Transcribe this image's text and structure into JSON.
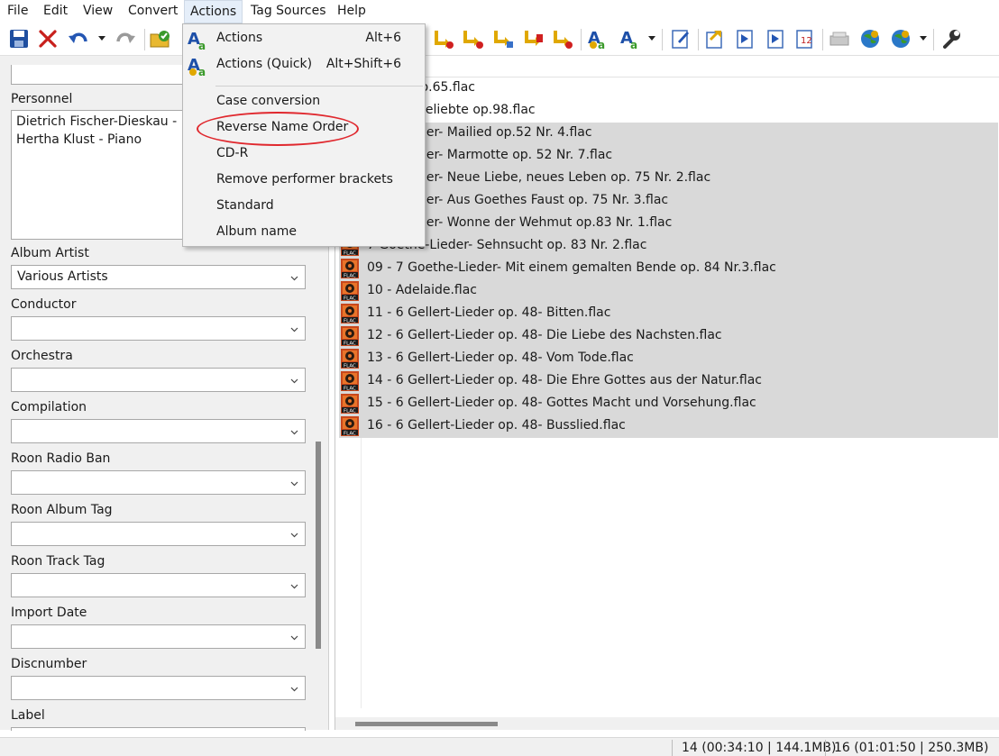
{
  "menubar": {
    "items": [
      "File",
      "Edit",
      "View",
      "Convert",
      "Actions",
      "Tag Sources",
      "Help"
    ]
  },
  "actions_menu": {
    "items": [
      {
        "label": "Actions",
        "shortcut": "Alt+6"
      },
      {
        "label": "Actions (Quick)",
        "shortcut": "Alt+Shift+6"
      },
      {
        "label": "Case conversion",
        "shortcut": ""
      },
      {
        "label": "Reverse Name Order",
        "shortcut": ""
      },
      {
        "label": "CD-R",
        "shortcut": ""
      },
      {
        "label": "Remove performer brackets",
        "shortcut": ""
      },
      {
        "label": "Standard",
        "shortcut": ""
      },
      {
        "label": "Album name",
        "shortcut": ""
      }
    ],
    "highlighted": "Reverse Name Order"
  },
  "tag_panel": {
    "personnel_label": "Personnel",
    "personnel_lines": [
      "Dietrich Fischer-Dieskau - Ba",
      "Hertha Klust - Piano"
    ],
    "fields": [
      {
        "label": "Album Artist",
        "value": "Various Artists"
      },
      {
        "label": "Conductor",
        "value": ""
      },
      {
        "label": "Orchestra",
        "value": ""
      },
      {
        "label": "Compilation",
        "value": ""
      },
      {
        "label": "Roon Radio Ban",
        "value": ""
      },
      {
        "label": "Roon Album Tag",
        "value": ""
      },
      {
        "label": "Roon Track Tag",
        "value": ""
      },
      {
        "label": "Import Date",
        "value": ""
      },
      {
        "label": "Discnumber",
        "value": ""
      },
      {
        "label": "Label",
        "value": ""
      }
    ]
  },
  "file_list": {
    "rows": [
      {
        "name": "erfido! op.65.flac",
        "selected": false
      },
      {
        "name": "e ferne Geliebte op.98.flac",
        "selected": false
      },
      {
        "name": "ethe-Lieder- Mailied op.52 Nr. 4.flac",
        "selected": true
      },
      {
        "name": "ethe-Lieder- Marmotte op. 52 Nr. 7.flac",
        "selected": true
      },
      {
        "name": "ethe-Lieder- Neue Liebe, neues Leben op. 75 Nr. 2.flac",
        "selected": true
      },
      {
        "name": "ethe-Lieder- Aus Goethes Faust op. 75 Nr. 3.flac",
        "selected": true
      },
      {
        "name": "ethe-Lieder- Wonne der Wehmut op.83 Nr. 1.flac",
        "selected": true
      },
      {
        "name": "7 Goethe-Lieder- Sehnsucht op. 83 Nr. 2.flac",
        "selected": true
      },
      {
        "name": "09 - 7 Goethe-Lieder- Mit einem gemalten Bende op. 84 Nr.3.flac",
        "selected": true
      },
      {
        "name": "10 - Adelaide.flac",
        "selected": true
      },
      {
        "name": "11 - 6 Gellert-Lieder op. 48- Bitten.flac",
        "selected": true
      },
      {
        "name": "12 - 6 Gellert-Lieder op. 48- Die Liebe des Nachsten.flac",
        "selected": true
      },
      {
        "name": "13 - 6 Gellert-Lieder op. 48- Vom Tode.flac",
        "selected": true
      },
      {
        "name": "14 - 6 Gellert-Lieder op. 48- Die Ehre Gottes aus der Natur.flac",
        "selected": true
      },
      {
        "name": "15 - 6 Gellert-Lieder op. 48- Gottes Macht und Vorsehung.flac",
        "selected": true
      },
      {
        "name": "16 - 6 Gellert-Lieder op. 48- Busslied.flac",
        "selected": true
      }
    ],
    "file_icon": "flac-file-icon"
  },
  "statusbar": {
    "selected": "14 (00:34:10 | 144.1MB)",
    "total": "16 (01:01:50 | 250.3MB)"
  },
  "colors": {
    "selection": "#d9d9d9",
    "highlight_ring": "#e0282e",
    "menu_bg": "#f2f2f2"
  }
}
